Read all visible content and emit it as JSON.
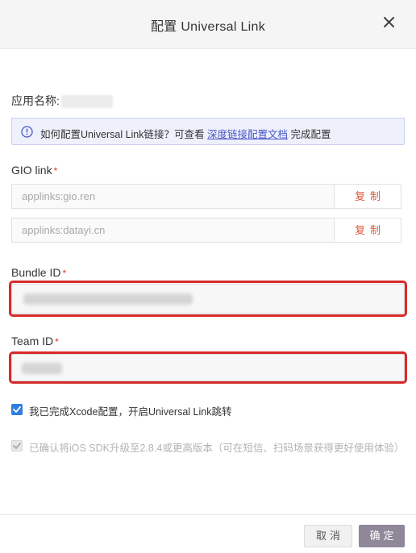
{
  "dialog": {
    "title": "配置 Universal Link",
    "close_icon": "close-icon"
  },
  "app": {
    "name_label": "应用名称:",
    "name_value_redacted": true
  },
  "info": {
    "icon": "info-circle-icon",
    "text_before": "如何配置Universal Link链接？可查看 ",
    "link_text": "深度链接配置文档",
    "text_after": " 完成配置",
    "accent_color": "#4a57c9"
  },
  "gio": {
    "label": "GIO link",
    "required_mark": "*",
    "links": [
      {
        "value": "applinks:gio.ren",
        "copy_label": "复制"
      },
      {
        "value": "applinks:datayi.cn",
        "copy_label": "复制"
      }
    ]
  },
  "bundle": {
    "label": "Bundle ID",
    "required_mark": "*",
    "value_redacted": true
  },
  "team": {
    "label": "Team ID",
    "required_mark": "*",
    "value_redacted": true
  },
  "checks": [
    {
      "label": "我已完成Xcode配置，开启Universal Link跳转",
      "checked": true,
      "disabled": false
    },
    {
      "label": "已确认将iOS SDK升级至2.8.4或更高版本（可在短信、扫码场景获得更好使用体验）",
      "checked": true,
      "disabled": true
    }
  ],
  "footer": {
    "cancel_label": "取消",
    "ok_label": "确定"
  },
  "colors": {
    "required": "#e0312a",
    "copy": "#e0573a",
    "highlight": "#d62a2a",
    "checkbox": "#2f7de1",
    "primary_button": "#8f8898"
  }
}
